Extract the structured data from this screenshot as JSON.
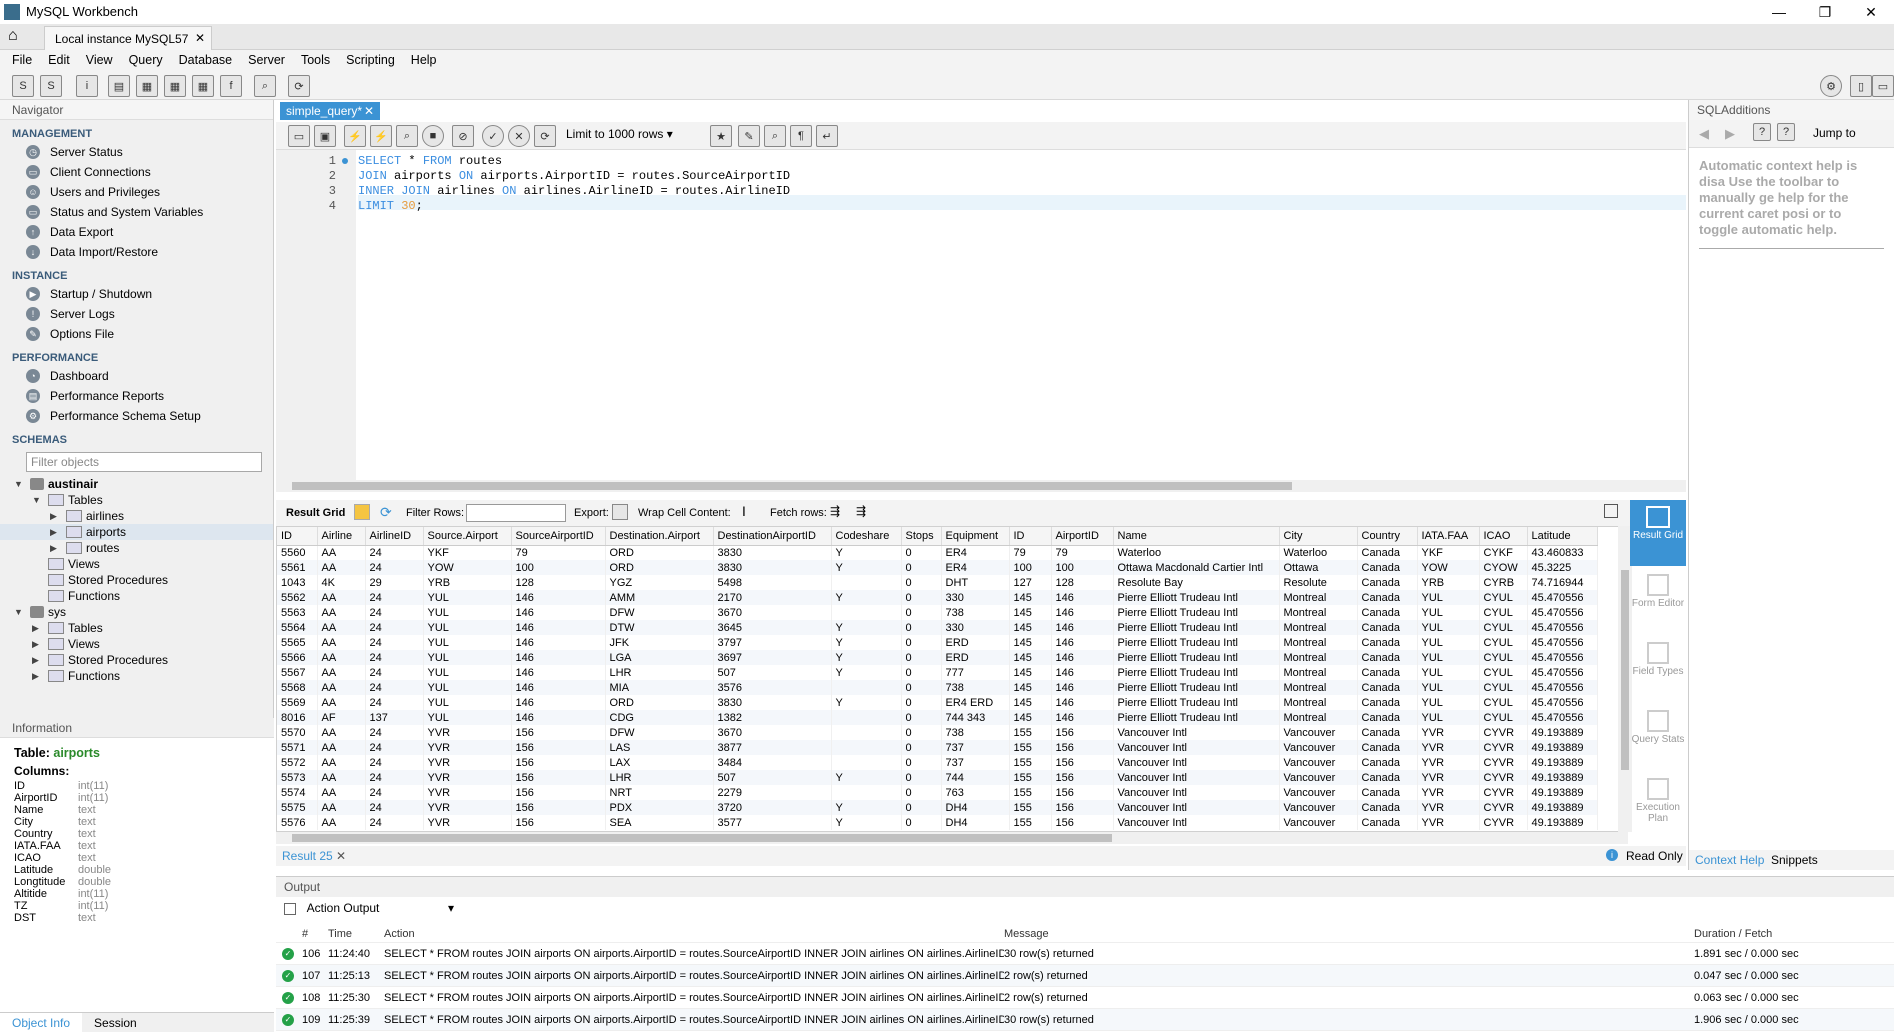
{
  "window": {
    "title": "MySQL Workbench",
    "minimize": "—",
    "maximize": "❐",
    "close": "✕"
  },
  "tabs": {
    "connection": "Local instance MySQL57"
  },
  "menu": [
    "File",
    "Edit",
    "View",
    "Query",
    "Database",
    "Server",
    "Tools",
    "Scripting",
    "Help"
  ],
  "navigator": {
    "title": "Navigator",
    "management_title": "MANAGEMENT",
    "management": [
      "Server Status",
      "Client Connections",
      "Users and Privileges",
      "Status and System Variables",
      "Data Export",
      "Data Import/Restore"
    ],
    "instance_title": "INSTANCE",
    "instance": [
      "Startup / Shutdown",
      "Server Logs",
      "Options File"
    ],
    "performance_title": "PERFORMANCE",
    "performance": [
      "Dashboard",
      "Performance Reports",
      "Performance Schema Setup"
    ],
    "schemas_title": "SCHEMAS",
    "filter_placeholder": "Filter objects",
    "tree": {
      "db1": "austinair",
      "tables": "Tables",
      "t1": "airlines",
      "t2": "airports",
      "t3": "routes",
      "views": "Views",
      "procs": "Stored Procedures",
      "funcs": "Functions",
      "db2": "sys",
      "tables2": "Tables",
      "views2": "Views",
      "procs2": "Stored Procedures",
      "funcs2": "Functions"
    }
  },
  "info": {
    "title": "Information",
    "table_label": "Table:",
    "table_name": "airports",
    "columns_label": "Columns:",
    "columns": [
      [
        "ID",
        "int(11)"
      ],
      [
        "AirportID",
        "int(11)"
      ],
      [
        "Name",
        "text"
      ],
      [
        "City",
        "text"
      ],
      [
        "Country",
        "text"
      ],
      [
        "IATA.FAA",
        "text"
      ],
      [
        "ICAO",
        "text"
      ],
      [
        "Latitude",
        "double"
      ],
      [
        "Longtitude",
        "double"
      ],
      [
        "Altitide",
        "int(11)"
      ],
      [
        "TZ",
        "int(11)"
      ],
      [
        "DST",
        "text"
      ]
    ],
    "tab_object": "Object Info",
    "tab_session": "Session"
  },
  "editor": {
    "tab": "simple_query*",
    "limit": "Limit to 1000 rows",
    "lines": [
      "1",
      "2",
      "3",
      "4"
    ]
  },
  "resultbar": {
    "grid": "Result Grid",
    "filter": "Filter Rows:",
    "export": "Export:",
    "wrap": "Wrap Cell Content:",
    "fetch": "Fetch rows:"
  },
  "grid": {
    "headers": [
      "ID",
      "Airline",
      "AirlineID",
      "Source.Airport",
      "SourceAirportID",
      "Destination.Airport",
      "DestinationAirportID",
      "Codeshare",
      "Stops",
      "Equipment",
      "ID",
      "AirportID",
      "Name",
      "City",
      "Country",
      "IATA.FAA",
      "ICAO",
      "Latitude"
    ],
    "rows": [
      [
        "5560",
        "AA",
        "24",
        "YKF",
        "79",
        "ORD",
        "3830",
        "Y",
        "0",
        "ER4",
        "79",
        "79",
        "Waterloo",
        "Waterloo",
        "Canada",
        "YKF",
        "CYKF",
        "43.460833"
      ],
      [
        "5561",
        "AA",
        "24",
        "YOW",
        "100",
        "ORD",
        "3830",
        "Y",
        "0",
        "ER4",
        "100",
        "100",
        "Ottawa Macdonald Cartier Intl",
        "Ottawa",
        "Canada",
        "YOW",
        "CYOW",
        "45.3225"
      ],
      [
        "1043",
        "4K",
        "29",
        "YRB",
        "128",
        "YGZ",
        "5498",
        "",
        "0",
        "DHT",
        "127",
        "128",
        "Resolute Bay",
        "Resolute",
        "Canada",
        "YRB",
        "CYRB",
        "74.716944"
      ],
      [
        "5562",
        "AA",
        "24",
        "YUL",
        "146",
        "AMM",
        "2170",
        "Y",
        "0",
        "330",
        "145",
        "146",
        "Pierre Elliott Trudeau Intl",
        "Montreal",
        "Canada",
        "YUL",
        "CYUL",
        "45.470556"
      ],
      [
        "5563",
        "AA",
        "24",
        "YUL",
        "146",
        "DFW",
        "3670",
        "",
        "0",
        "738",
        "145",
        "146",
        "Pierre Elliott Trudeau Intl",
        "Montreal",
        "Canada",
        "YUL",
        "CYUL",
        "45.470556"
      ],
      [
        "5564",
        "AA",
        "24",
        "YUL",
        "146",
        "DTW",
        "3645",
        "Y",
        "0",
        "330",
        "145",
        "146",
        "Pierre Elliott Trudeau Intl",
        "Montreal",
        "Canada",
        "YUL",
        "CYUL",
        "45.470556"
      ],
      [
        "5565",
        "AA",
        "24",
        "YUL",
        "146",
        "JFK",
        "3797",
        "Y",
        "0",
        "ERD",
        "145",
        "146",
        "Pierre Elliott Trudeau Intl",
        "Montreal",
        "Canada",
        "YUL",
        "CYUL",
        "45.470556"
      ],
      [
        "5566",
        "AA",
        "24",
        "YUL",
        "146",
        "LGA",
        "3697",
        "Y",
        "0",
        "ERD",
        "145",
        "146",
        "Pierre Elliott Trudeau Intl",
        "Montreal",
        "Canada",
        "YUL",
        "CYUL",
        "45.470556"
      ],
      [
        "5567",
        "AA",
        "24",
        "YUL",
        "146",
        "LHR",
        "507",
        "Y",
        "0",
        "777",
        "145",
        "146",
        "Pierre Elliott Trudeau Intl",
        "Montreal",
        "Canada",
        "YUL",
        "CYUL",
        "45.470556"
      ],
      [
        "5568",
        "AA",
        "24",
        "YUL",
        "146",
        "MIA",
        "3576",
        "",
        "0",
        "738",
        "145",
        "146",
        "Pierre Elliott Trudeau Intl",
        "Montreal",
        "Canada",
        "YUL",
        "CYUL",
        "45.470556"
      ],
      [
        "5569",
        "AA",
        "24",
        "YUL",
        "146",
        "ORD",
        "3830",
        "Y",
        "0",
        "ER4 ERD",
        "145",
        "146",
        "Pierre Elliott Trudeau Intl",
        "Montreal",
        "Canada",
        "YUL",
        "CYUL",
        "45.470556"
      ],
      [
        "8016",
        "AF",
        "137",
        "YUL",
        "146",
        "CDG",
        "1382",
        "",
        "0",
        "744 343",
        "145",
        "146",
        "Pierre Elliott Trudeau Intl",
        "Montreal",
        "Canada",
        "YUL",
        "CYUL",
        "45.470556"
      ],
      [
        "5570",
        "AA",
        "24",
        "YVR",
        "156",
        "DFW",
        "3670",
        "",
        "0",
        "738",
        "155",
        "156",
        "Vancouver Intl",
        "Vancouver",
        "Canada",
        "YVR",
        "CYVR",
        "49.193889"
      ],
      [
        "5571",
        "AA",
        "24",
        "YVR",
        "156",
        "LAS",
        "3877",
        "",
        "0",
        "737",
        "155",
        "156",
        "Vancouver Intl",
        "Vancouver",
        "Canada",
        "YVR",
        "CYVR",
        "49.193889"
      ],
      [
        "5572",
        "AA",
        "24",
        "YVR",
        "156",
        "LAX",
        "3484",
        "",
        "0",
        "737",
        "155",
        "156",
        "Vancouver Intl",
        "Vancouver",
        "Canada",
        "YVR",
        "CYVR",
        "49.193889"
      ],
      [
        "5573",
        "AA",
        "24",
        "YVR",
        "156",
        "LHR",
        "507",
        "Y",
        "0",
        "744",
        "155",
        "156",
        "Vancouver Intl",
        "Vancouver",
        "Canada",
        "YVR",
        "CYVR",
        "49.193889"
      ],
      [
        "5574",
        "AA",
        "24",
        "YVR",
        "156",
        "NRT",
        "2279",
        "",
        "0",
        "763",
        "155",
        "156",
        "Vancouver Intl",
        "Vancouver",
        "Canada",
        "YVR",
        "CYVR",
        "49.193889"
      ],
      [
        "5575",
        "AA",
        "24",
        "YVR",
        "156",
        "PDX",
        "3720",
        "Y",
        "0",
        "DH4",
        "155",
        "156",
        "Vancouver Intl",
        "Vancouver",
        "Canada",
        "YVR",
        "CYVR",
        "49.193889"
      ],
      [
        "5576",
        "AA",
        "24",
        "YVR",
        "156",
        "SEA",
        "3577",
        "Y",
        "0",
        "DH4",
        "155",
        "156",
        "Vancouver Intl",
        "Vancouver",
        "Canada",
        "YVR",
        "CYVR",
        "49.193889"
      ]
    ]
  },
  "side_panel": [
    "Result Grid",
    "Form Editor",
    "Field Types",
    "Query Stats",
    "Execution Plan"
  ],
  "status": {
    "result_tab": "Result 25",
    "read_only": "Read Only",
    "context_help": "Context Help",
    "snippets": "Snippets"
  },
  "output": {
    "title": "Output",
    "selector": "Action Output",
    "headers": [
      "#",
      "Time",
      "Action",
      "Message",
      "Duration / Fetch"
    ],
    "rows": [
      [
        "106",
        "11:24:40",
        "SELECT * FROM routes JOIN airports ON airports.AirportID = routes.SourceAirportID INNER JOIN airlines ON airlines.AirlineID = routes.AirlineID ...",
        "30 row(s) returned",
        "1.891 sec / 0.000 sec"
      ],
      [
        "107",
        "11:25:13",
        "SELECT * FROM routes JOIN airports ON airports.AirportID = routes.SourceAirportID INNER JOIN airlines ON airlines.AirlineID = routes.AirlineID ...",
        "2 row(s) returned",
        "0.047 sec / 0.000 sec"
      ],
      [
        "108",
        "11:25:30",
        "SELECT * FROM routes JOIN airports ON airports.AirportID = routes.SourceAirportID INNER JOIN airlines ON airlines.AirlineID = routes.AirlineID ...",
        "2 row(s) returned",
        "0.063 sec / 0.000 sec"
      ],
      [
        "109",
        "11:25:39",
        "SELECT * FROM routes JOIN airports ON airports.AirportID = routes.SourceAirportID INNER JOIN airlines ON airlines.AirlineID = routes.AirlineID ...",
        "30 row(s) returned",
        "1.906 sec / 0.000 sec"
      ]
    ]
  },
  "sqladditions": {
    "title": "SQLAdditions",
    "jump": "Jump to",
    "help": "Automatic context help is disa Use the toolbar to manually ge help for the current caret posi or to toggle automatic help."
  },
  "colors": {
    "accent": "#3b93d4",
    "keyword": "#3b8ee0",
    "number": "#e69a3c",
    "ok": "#24a148"
  }
}
